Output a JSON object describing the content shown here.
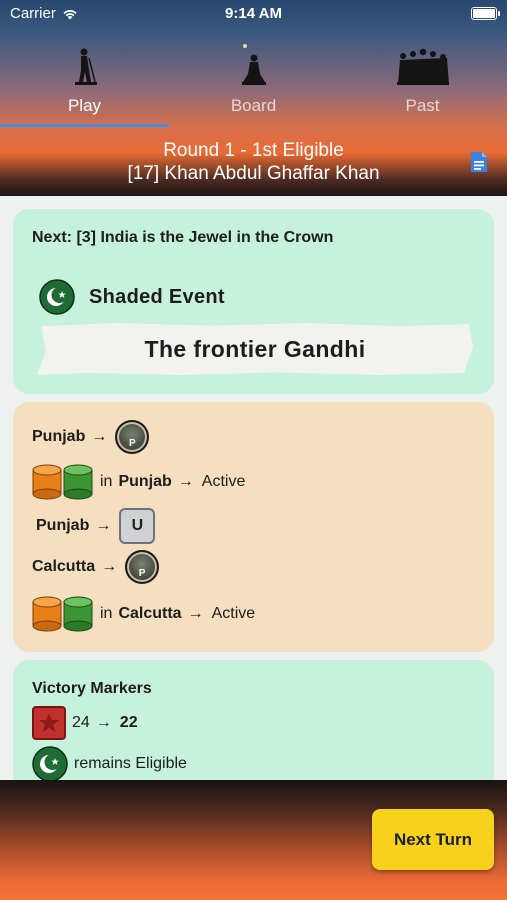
{
  "status_bar": {
    "carrier": "Carrier",
    "time": "9:14 AM"
  },
  "tabs": [
    {
      "label": "Play",
      "icon": "gandhi-walking-icon",
      "active": true
    },
    {
      "label": "Board",
      "icon": "seated-figure-icon",
      "active": false
    },
    {
      "label": "Past",
      "icon": "crowd-march-icon",
      "active": false
    }
  ],
  "round": {
    "line1": "Round 1 - 1st Eligible",
    "line2": "[17] Khan Abdul Ghaffar Khan"
  },
  "next_card": {
    "title": "Next: [3] India is the Jewel in the Crown",
    "shaded_label": "Shaded Event",
    "event_name": "The frontier Gandhi",
    "faction_icon": "crescent-star-icon"
  },
  "actions": {
    "row1": {
      "place": "Punjab",
      "arrow": "→",
      "icon": "prisoner-coin-icon",
      "coin_letter": "P"
    },
    "row2": {
      "prefix": "in",
      "place": "Punjab",
      "arrow": "→",
      "result": "Active"
    },
    "row3": {
      "place": "Punjab",
      "arrow": "→",
      "marker": "U"
    },
    "row4": {
      "place": "Calcutta",
      "arrow": "→",
      "icon": "prisoner-coin-icon",
      "coin_letter": "P"
    },
    "row5": {
      "prefix": "in",
      "place": "Calcutta",
      "arrow": "→",
      "result": "Active"
    }
  },
  "victory": {
    "title": "Victory Markers",
    "from": "24",
    "arrow": "→",
    "to": "22",
    "eligible_text": "remains Eligible"
  },
  "footer": {
    "next_turn_label": "Next Turn"
  },
  "colors": {
    "card_green": "#c6f1dd",
    "card_tan": "#f5dfc0",
    "orange_cylinder": "#f28b1d",
    "green_cylinder": "#3f9a3a",
    "button_yellow": "#f6d21c",
    "tab_indicator": "#4a8de0",
    "doc_icon": "#3b82e0"
  }
}
